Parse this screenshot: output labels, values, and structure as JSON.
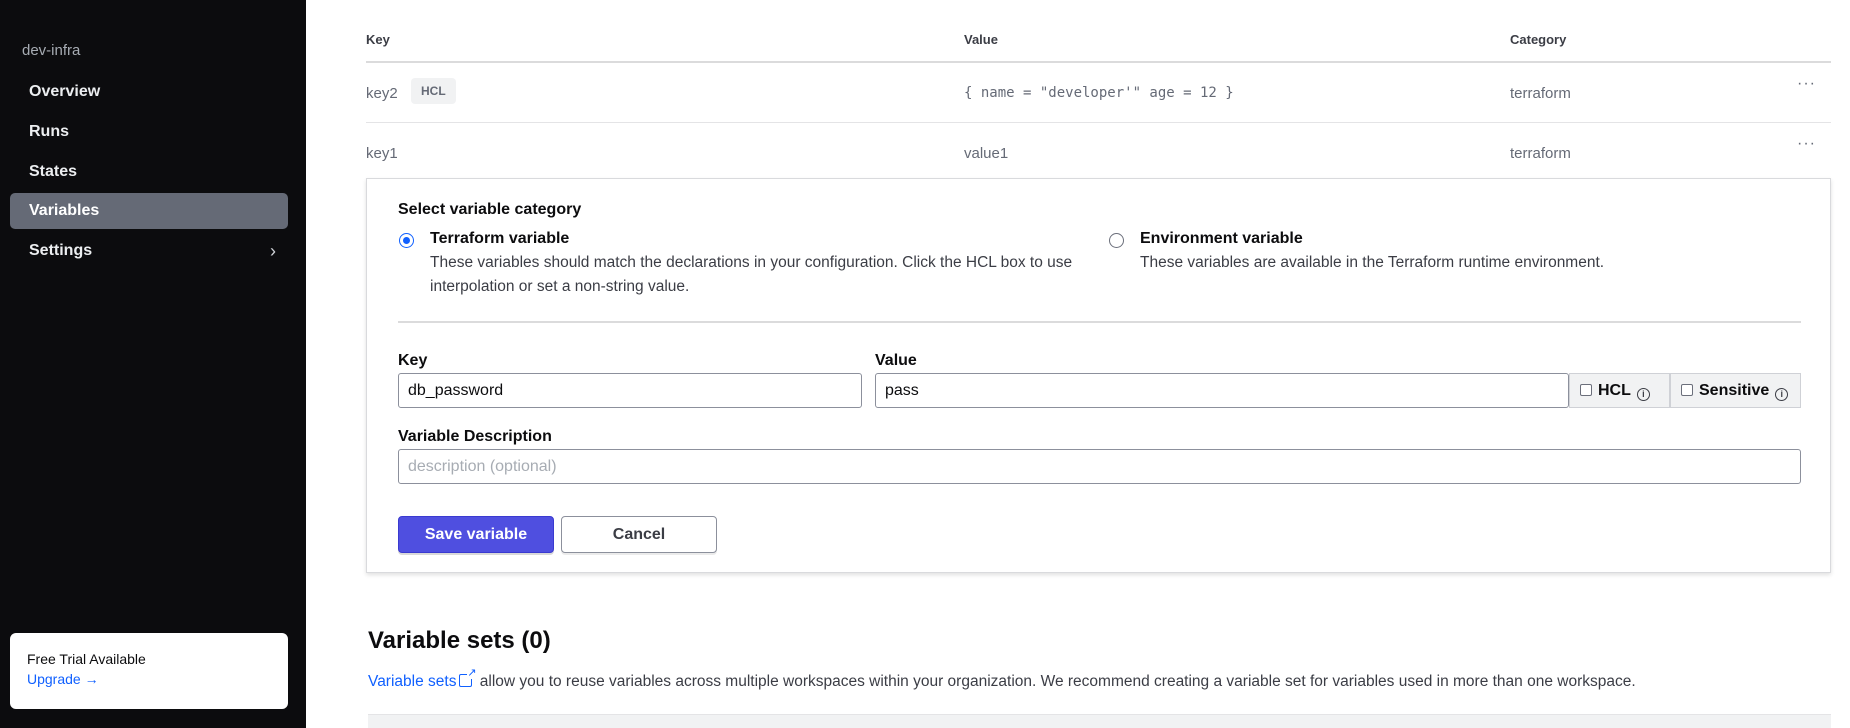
{
  "sidebar": {
    "workspace": "dev-infra",
    "items": [
      {
        "label": "Overview"
      },
      {
        "label": "Runs"
      },
      {
        "label": "States"
      },
      {
        "label": "Variables"
      },
      {
        "label": "Settings"
      }
    ],
    "trial": {
      "title": "Free Trial Available",
      "link": "Upgrade"
    }
  },
  "table": {
    "headers": {
      "key": "Key",
      "value": "Value",
      "category": "Category"
    },
    "rows": [
      {
        "key": "key2",
        "badge": "HCL",
        "value": "{ name = \"developer'\" age = 12 }",
        "category": "terraform",
        "actions": "···"
      },
      {
        "key": "key1",
        "value": "value1",
        "category": "terraform",
        "actions": "···"
      }
    ]
  },
  "form": {
    "legend": "Select variable category",
    "terraform": {
      "title": "Terraform variable",
      "desc1": "These variables should match the declarations in your configuration. Click the HCL box to use",
      "desc2": "interpolation or set a non-string value.",
      "selected": true
    },
    "environment": {
      "title": "Environment variable",
      "desc": "These variables are available in the Terraform runtime environment.",
      "selected": false
    },
    "key_label": "Key",
    "key_value": "db_password",
    "value_label": "Value",
    "value_value": "pass",
    "hcl_label": "HCL",
    "sensitive_label": "Sensitive",
    "info": "i",
    "desc_label": "Variable Description",
    "desc_placeholder": "description (optional)",
    "save": "Save variable",
    "cancel": "Cancel"
  },
  "sets": {
    "title": "Variable sets (0)",
    "link": "Variable sets",
    "text": "allow you to reuse variables across multiple workspaces within your organization. We recommend creating a variable set for variables used in more than one workspace."
  }
}
